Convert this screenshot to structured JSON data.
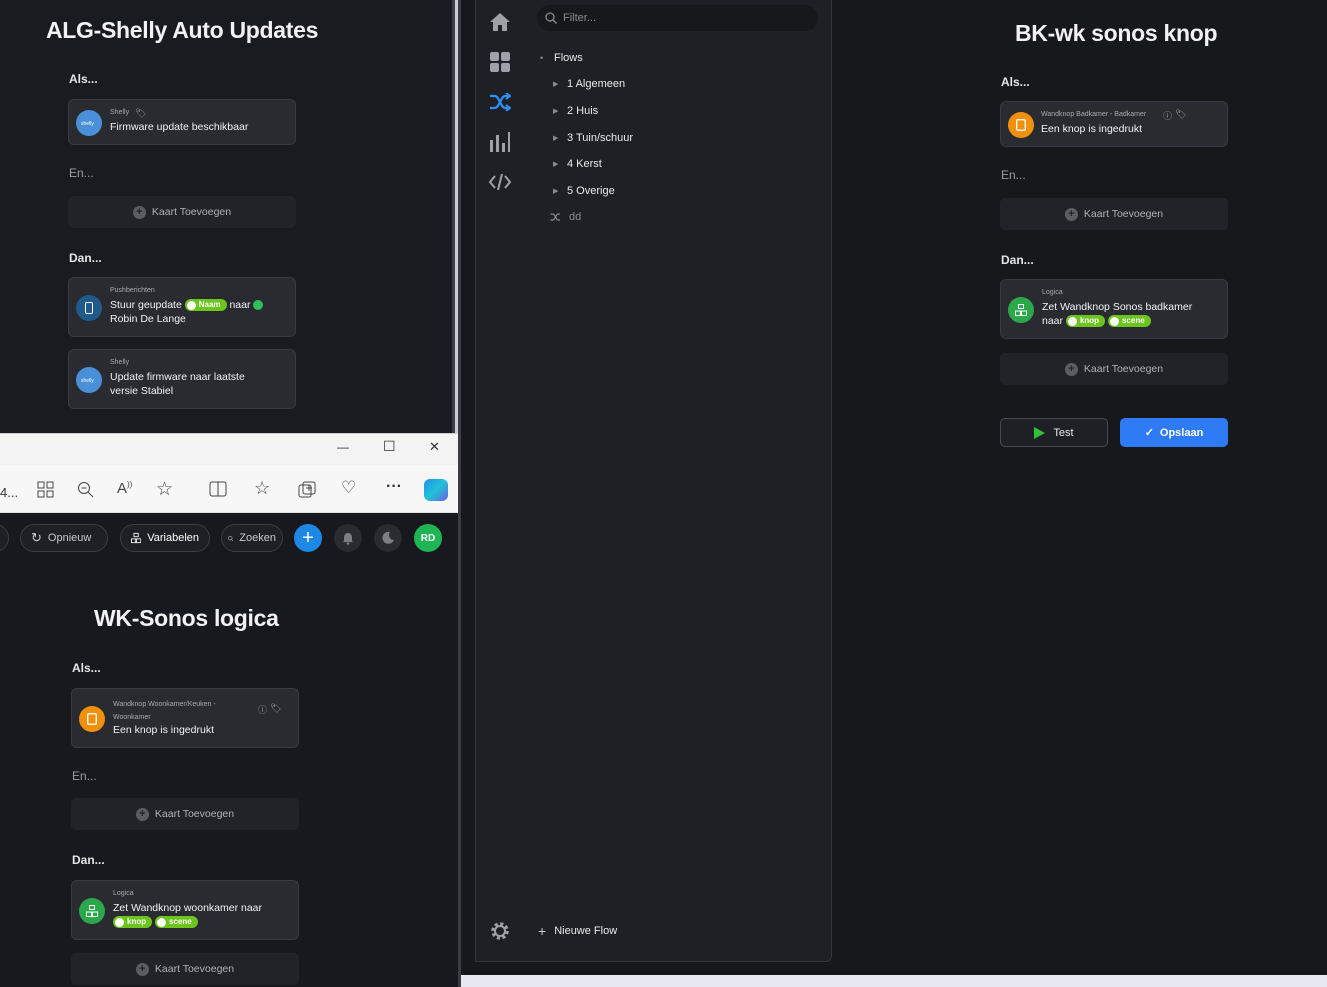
{
  "left_top": {
    "title": "ALG-Shelly Auto Updates",
    "als": "Als...",
    "en": "En...",
    "dan": "Dan...",
    "trigger": {
      "category": "Shelly",
      "text": "Firmware update beschikbaar"
    },
    "add_label": "Kaart Toevoegen",
    "action1": {
      "category": "Pushberichten",
      "text_a": "Stuur geupdate",
      "pill": "Naam",
      "text_b": "naar",
      "text_c": "Robin De Lange"
    },
    "action2": {
      "category": "Shelly",
      "text": "Update firmware naar laatste versie Stabiel"
    }
  },
  "browser": {
    "title_ellipsis": "4...",
    "controls": {
      "minimize": "—",
      "maximize": "☐",
      "close": "✕"
    },
    "toolbar_icons": [
      "apps-icon",
      "zoom-out-icon",
      "read-aloud-icon",
      "favorite-icon",
      "split-screen-icon",
      "favorites-icon",
      "collections-icon",
      "health-icon",
      "more-icon",
      "copilot-icon"
    ],
    "more_label": "···",
    "app_toolbar": {
      "refresh_label": "Opnieuw",
      "variables_label": "Variabelen",
      "search_placeholder": "Zoeken",
      "avatar_initials": "RD"
    },
    "flow": {
      "title": "WK-Sonos logica",
      "als": "Als...",
      "en": "En...",
      "dan": "Dan...",
      "trigger": {
        "category": "Wandknop Woonkamer/Keuken - Woonkamer",
        "text": "Een knop is ingedrukt"
      },
      "add_label": "Kaart Toevoegen",
      "action": {
        "category": "Logica",
        "text": "Zet Wandknop woonkamer naar",
        "pill1": "knop",
        "pill2": "scene"
      }
    }
  },
  "homey": {
    "filter_placeholder": "Filter...",
    "root_label": "Flows",
    "folders": [
      "1 Algemeen",
      "2 Huis",
      "3 Tuin/schuur",
      "4 Kerst",
      "5 Overige"
    ],
    "loose_flow": "dd",
    "new_flow_label": "Nieuwe Flow"
  },
  "right_flow": {
    "title": "BK-wk sonos knop",
    "als": "Als...",
    "en": "En...",
    "dan": "Dan...",
    "trigger": {
      "category": "Wandknop Badkamer - Badkamer",
      "text": "Een knop is ingedrukt"
    },
    "add_label": "Kaart Toevoegen",
    "action": {
      "category": "Logica",
      "text_a": "Zet Wandknop Sonos badkamer",
      "text_b": "naar",
      "pill1": "knop",
      "pill2": "scene"
    },
    "test_label": "Test",
    "save_label": "Opslaan"
  },
  "colors": {
    "accent_blue": "#2e7bf5",
    "shelly_blue": "#4a90d9",
    "button_orange": "#f0900f",
    "logic_green": "#2ba84a",
    "pill_green": "#6cc51d",
    "avatar_green": "#1fb554"
  }
}
